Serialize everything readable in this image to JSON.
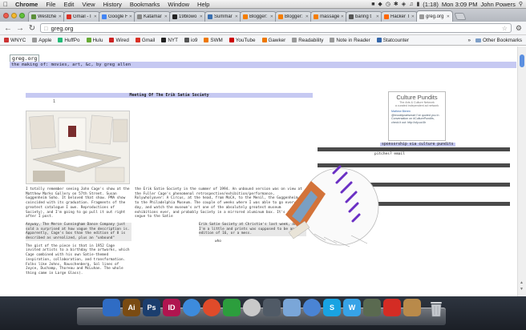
{
  "menubar": {
    "app": "Chrome",
    "items": [
      "File",
      "Edit",
      "View",
      "History",
      "Bookmarks",
      "Window",
      "Help"
    ],
    "battery": "(1:18)",
    "clock": "Mon 3:09 PM",
    "user": "John Powers"
  },
  "tabs": [
    {
      "label": "Westche",
      "color": "#5b8f3a"
    },
    {
      "label": "Gmail - I",
      "color": "#d93025"
    },
    {
      "label": "Google F",
      "color": "#4285f4"
    },
    {
      "label": "Katamar",
      "color": "#888888"
    },
    {
      "label": "19blowo",
      "color": "#222222"
    },
    {
      "label": "Summar",
      "color": "#3a6fb0"
    },
    {
      "label": "Blogger:",
      "color": "#f57d00"
    },
    {
      "label": "Blogger:",
      "color": "#f57d00"
    },
    {
      "label": "massage",
      "color": "#f57d00"
    },
    {
      "label": "baring t",
      "color": "#555555"
    },
    {
      "label": "Hacker T",
      "color": "#ff6600"
    },
    {
      "label": "greg.org",
      "color": "#999999",
      "active": true
    }
  ],
  "omnibox": {
    "url": "greg.org"
  },
  "bookmarks": [
    {
      "label": "WNYC",
      "color": "#c33"
    },
    {
      "label": "Apple",
      "color": "#999"
    },
    {
      "label": "HuffPo",
      "color": "#2b7"
    },
    {
      "label": "Hulu",
      "color": "#6a3"
    },
    {
      "label": "Wired",
      "color": "#c22"
    },
    {
      "label": "Gmail",
      "color": "#d93025"
    },
    {
      "label": "NYT",
      "color": "#222"
    },
    {
      "label": "io9",
      "color": "#555"
    },
    {
      "label": "SWM",
      "color": "#e70"
    },
    {
      "label": "YouTube",
      "color": "#c00"
    },
    {
      "label": "Gawker",
      "color": "#e70"
    },
    {
      "label": "Readability",
      "color": "#999"
    },
    {
      "label": "Note in Reader",
      "color": "#999"
    },
    {
      "label": "Statcounter",
      "color": "#36a"
    }
  ],
  "bookmarks_more": "»",
  "bookmarks_other": "Other Bookmarks",
  "site": {
    "title": "greg.org",
    "subtitle": "the making of: movies, art, &c, by greg allen",
    "post_title": "Meeting Of The Erik Satie Society",
    "post_meta": "1",
    "col1": [
      "I totally remember seeing John Cage's show at the Matthew Marks Gallery on 57th Street. Susan Guggenheim Soho. It beloved that show. PMA show coincided with its graduation. Fragments of the greatest catalogue I own. Reproductions of Society), and I'm going to go pull it out right after I post.",
      "Anyway, The Merce Cunningham Dance Company just sold a surprised at how vague the description is. Apparently, Cage's box than the edition of 8 is described as unrealized, plus an \"unbound\"",
      "The gist of the piece is that in 1952 Cage invited artists to a birthday the artworks, which Cage combined with his own Satie-themed inspiration, collaboration, and transformation. Folks like Johns, Rauschenberg, Sol lines of Joyce, Duchamp, Thoreau and McLuhan. The whole thing came in Large Glass)."
    ],
    "col2": [
      "the Erik Satie Society in the summer of 1994. An unbound version was on view at the Fuller Cage's phenomenal retrospective/exhibition/performance, Rolywholyover: A Circus, at the head, from MoCA, to the Menil, the Guggenheim, to the Philadelphia Museum. The couple of weeks where I was able to go every day, and watch the museum's art one of the absolutely greatest museum exhibitions ever, and probably Society in a mirrored aluminum box. It's a good segue to the Satie",
      "Erik Satie Society at Christie's last week, and I'm a little and prints was supposed to be an edition of 16, or a mess.",
      "who"
    ]
  },
  "sidebar": {
    "title": "Culture Pundits",
    "subtitle": "The Arts & Culture Network",
    "tagline": "a curated independent ad network",
    "tweet_user": "Mathew Bieren",
    "tweet": "@brooklynartsmart I've quoted you in Conversation on #CulturePundits, check it out: http://sfy.co/4h",
    "sponsor": "sponsorship via culture pundits"
  },
  "bars": {
    "pitches": "pitches? email"
  },
  "dock": [
    {
      "name": "finder",
      "color": "#2f6cc4",
      "glyph": ""
    },
    {
      "name": "illustrator",
      "color": "#7a4b12",
      "glyph": "Ai"
    },
    {
      "name": "photoshop",
      "color": "#1b3e6e",
      "glyph": "Ps"
    },
    {
      "name": "indesign",
      "color": "#b0154f",
      "glyph": "ID"
    },
    {
      "name": "safari",
      "color": "#3d8bdc",
      "glyph": ""
    },
    {
      "name": "chrome",
      "color": "#e04b2a",
      "glyph": ""
    },
    {
      "name": "twitterrific",
      "color": "#2c9e3d",
      "glyph": ""
    },
    {
      "name": "ical",
      "color": "#c9c9c9",
      "glyph": ""
    },
    {
      "name": "facetime",
      "color": "#505a66",
      "glyph": ""
    },
    {
      "name": "mail",
      "color": "#7aa6d8",
      "glyph": ""
    },
    {
      "name": "itunes",
      "color": "#4a84d4",
      "glyph": ""
    },
    {
      "name": "skype",
      "color": "#19a3e2",
      "glyph": "S"
    },
    {
      "name": "wacom",
      "color": "#37a3e7",
      "glyph": "W"
    },
    {
      "name": "preview",
      "color": "#5a6a50",
      "glyph": ""
    },
    {
      "name": "acrobat",
      "color": "#d42c24",
      "glyph": ""
    },
    {
      "name": "documents",
      "color": "#b98a4a",
      "glyph": ""
    }
  ]
}
